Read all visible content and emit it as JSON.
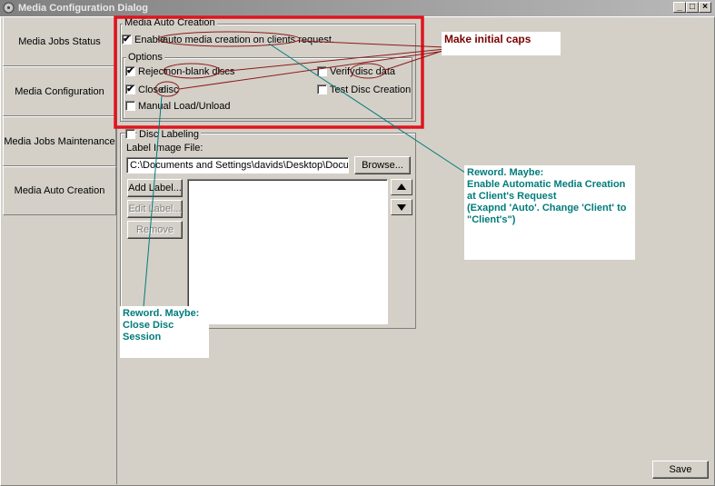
{
  "window": {
    "title": "Media Configuration Dialog",
    "minimize_label": "_",
    "maximize_label": "□",
    "close_label": "×"
  },
  "tabs": [
    {
      "label": "Media Jobs Status"
    },
    {
      "label": "Media Configuration"
    },
    {
      "label": "Media Jobs Maintenance"
    },
    {
      "label": "Media Auto Creation"
    }
  ],
  "auto_creation": {
    "group_label": "Media Auto Creation",
    "enable_prefix": "Enable",
    "enable_rest": "auto media creation on clients request.",
    "enable_checked": "✔",
    "options_label": "Options",
    "reject_prefix": "Reject",
    "reject_rest": "non-blank discs",
    "reject_checked": "✔",
    "close_prefix": "Close",
    "close_rest": "disc",
    "close_checked": "✔",
    "manual_label": "Manual Load/Unload",
    "verify_prefix": "Verify",
    "verify_rest": "disc data",
    "test_label": "Test Disc Creation"
  },
  "disc_labeling": {
    "group_label": "Disc Labeling",
    "image_file_label": "Label Image File:",
    "image_file_value": "C:\\Documents and Settings\\davids\\Desktop\\Documentation\\I",
    "browse_label": "Browse...",
    "add_label": "Add Label...",
    "edit_label": "Edit Label...",
    "remove_label": "Remove"
  },
  "footer": {
    "save_label": "Save"
  },
  "annotations": {
    "initial_caps": "Make initial caps",
    "reword_enable": [
      "Reword. Maybe:",
      "Enable Automatic Media Creation",
      "at Client's Request",
      "(Exapnd 'Auto'. Change 'Client' to",
      "\"Client's\")"
    ],
    "reword_close": [
      "Reword. Maybe:",
      "Close Disc Session"
    ],
    "colors": {
      "highlight_box": "#e0141e",
      "circle_stroke": "#8b1a1a",
      "teal_line": "#007b7b",
      "maroon_line": "#8b1a1a"
    }
  }
}
